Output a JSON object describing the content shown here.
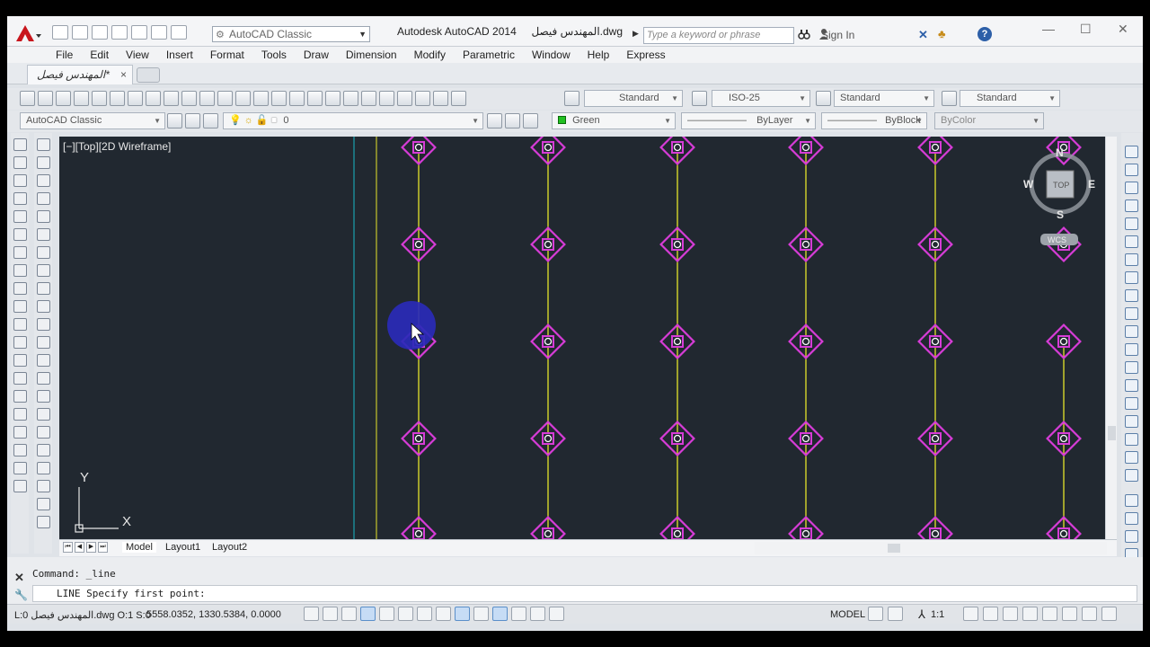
{
  "app": {
    "title": "Autodesk AutoCAD 2014",
    "filename": "المهندس فيصل.dwg",
    "workspace": "AutoCAD Classic"
  },
  "search": {
    "placeholder": "Type a keyword or phrase"
  },
  "account": {
    "signin_label": "Sign In",
    "help_label": "?"
  },
  "menu": [
    "File",
    "Edit",
    "View",
    "Insert",
    "Format",
    "Tools",
    "Draw",
    "Dimension",
    "Modify",
    "Parametric",
    "Window",
    "Help",
    "Express"
  ],
  "doc_tab": {
    "label": "المهندس فيصل*",
    "close": "×"
  },
  "toolbars": {
    "text_style": "Standard",
    "dim_style": "ISO-25",
    "table_style": "Standard",
    "mleader_style": "Standard",
    "workspace_combo": "AutoCAD Classic",
    "layer": "0",
    "color": "Green",
    "linetype": "ByLayer",
    "lineweight": "ByBlock",
    "plotstyle": "ByColor"
  },
  "viewport": {
    "label": "[−][Top][2D Wireframe]",
    "viewcube": {
      "top": "TOP",
      "north": "N",
      "south": "S",
      "east": "E",
      "west": "W",
      "wcs": "WCS"
    },
    "ucs": {
      "x": "X",
      "y": "Y"
    }
  },
  "layout_tabs": [
    "Model",
    "Layout1",
    "Layout2"
  ],
  "command": {
    "history": "Command: _line",
    "prompt": "LINE Specify first point:"
  },
  "status": {
    "file": "L:0 المهندس فيصل.dwg O:1 S:0",
    "coords": "5558.0352, 1330.5384, 0.0000",
    "space": "MODEL",
    "scale": "1:1"
  },
  "colors": {
    "background": "#212830",
    "column_marker": "#d63cd6",
    "grid_line": "#e5e52a",
    "cyan_line": "#19b7c8",
    "cursor_highlight": "#2a2ab8"
  }
}
